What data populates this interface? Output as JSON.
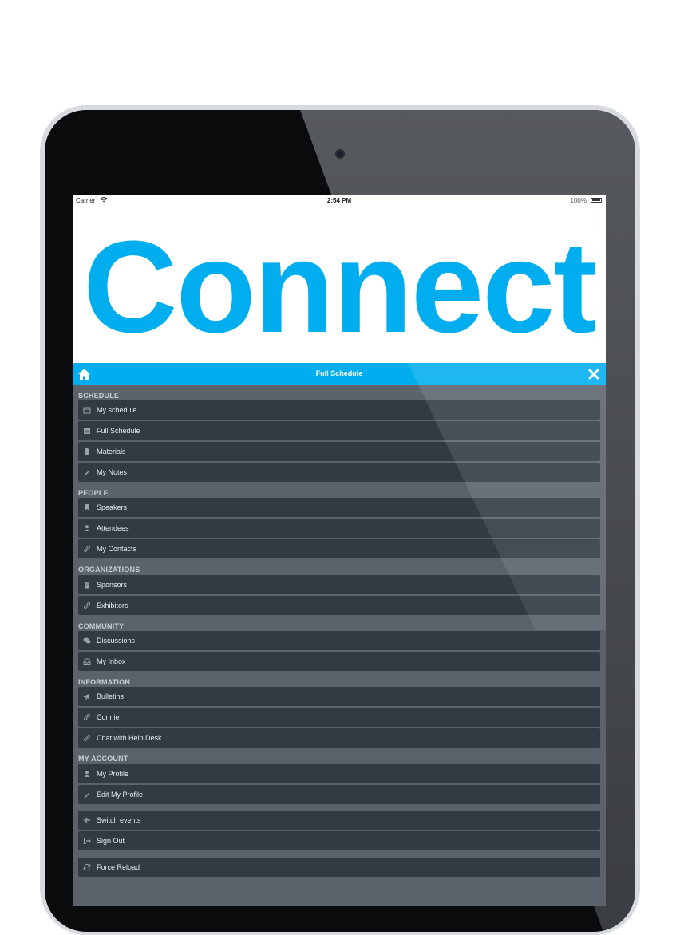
{
  "status_bar": {
    "carrier": "Carrier",
    "time": "2:54 PM",
    "battery": "100%"
  },
  "logo": {
    "text": "Connect",
    "color": "#00aeef"
  },
  "navbar": {
    "title": "Full Schedule",
    "home_icon": "home-icon",
    "close_icon": "close-icon"
  },
  "colors": {
    "accent": "#00aeef",
    "item_bg": "#333a44",
    "panel_bg": "#5b626b"
  },
  "menu": {
    "sections": [
      {
        "title": "SCHEDULE",
        "items": [
          {
            "label": "My schedule",
            "icon": "calendar-icon"
          },
          {
            "label": "Full Schedule",
            "icon": "calendar-grid-icon"
          },
          {
            "label": "Materials",
            "icon": "file-icon"
          },
          {
            "label": "My Notes",
            "icon": "pencil-icon"
          }
        ]
      },
      {
        "title": "PEOPLE",
        "items": [
          {
            "label": "Speakers",
            "icon": "bookmark-icon"
          },
          {
            "label": "Attendees",
            "icon": "user-icon"
          },
          {
            "label": "My Contacts",
            "icon": "link-icon"
          }
        ]
      },
      {
        "title": "ORGANIZATIONS",
        "items": [
          {
            "label": "Sponsors",
            "icon": "building-icon"
          },
          {
            "label": "Exhibitors",
            "icon": "link-icon"
          }
        ]
      },
      {
        "title": "COMMUNITY",
        "items": [
          {
            "label": "Discussions",
            "icon": "comments-icon"
          },
          {
            "label": "My Inbox",
            "icon": "inbox-icon"
          }
        ]
      },
      {
        "title": "INFORMATION",
        "items": [
          {
            "label": "Bulletins",
            "icon": "megaphone-icon"
          },
          {
            "label": "Connie",
            "icon": "link-icon"
          },
          {
            "label": "Chat with Help Desk",
            "icon": "link-icon"
          }
        ]
      },
      {
        "title": "MY ACCOUNT",
        "items": [
          {
            "label": "My Profile",
            "icon": "user-icon"
          },
          {
            "label": "Edit My Profile",
            "icon": "pencil-icon"
          }
        ]
      }
    ],
    "actions": [
      {
        "label": "Switch events",
        "icon": "arrow-left-icon"
      },
      {
        "label": "Sign Out",
        "icon": "sign-out-icon"
      },
      {
        "label": "Force Reload",
        "icon": "refresh-icon"
      }
    ]
  }
}
